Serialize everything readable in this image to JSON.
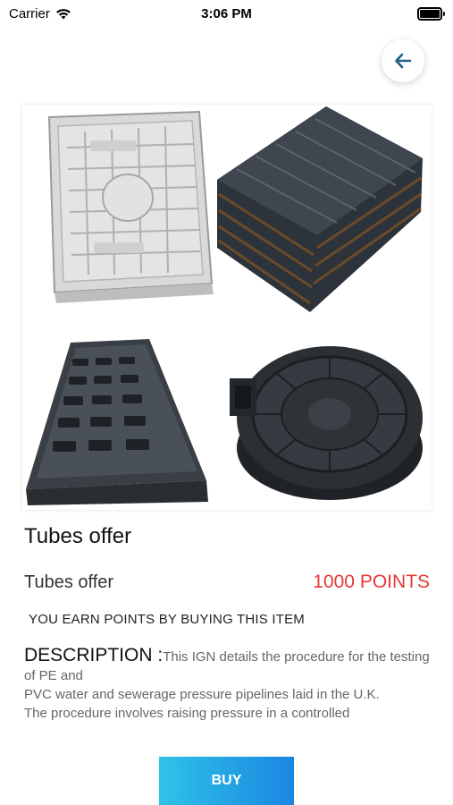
{
  "status_bar": {
    "carrier": "Carrier",
    "time": "3:06 PM"
  },
  "product": {
    "title": "Tubes offer",
    "name": "Tubes offer",
    "points": "1000 POINTS",
    "earn_text": "YOU EARN POINTS BY BUYING THIS ITEM",
    "description_label": "DESCRIPTION :",
    "description_text": "This IGN details the procedure for the testing of PE and\nPVC water and sewerage pressure pipelines laid in the U.K.\nThe procedure involves raising pressure in a controlled"
  },
  "actions": {
    "buy_label": "BUY"
  },
  "colors": {
    "points": "#e53935",
    "buy_gradient_start": "#2fc3e8",
    "buy_gradient_end": "#1a86e0",
    "back_arrow": "#1f5f87"
  },
  "icons": {
    "back": "arrow-left-icon",
    "wifi": "wifi-icon",
    "battery": "battery-icon"
  }
}
